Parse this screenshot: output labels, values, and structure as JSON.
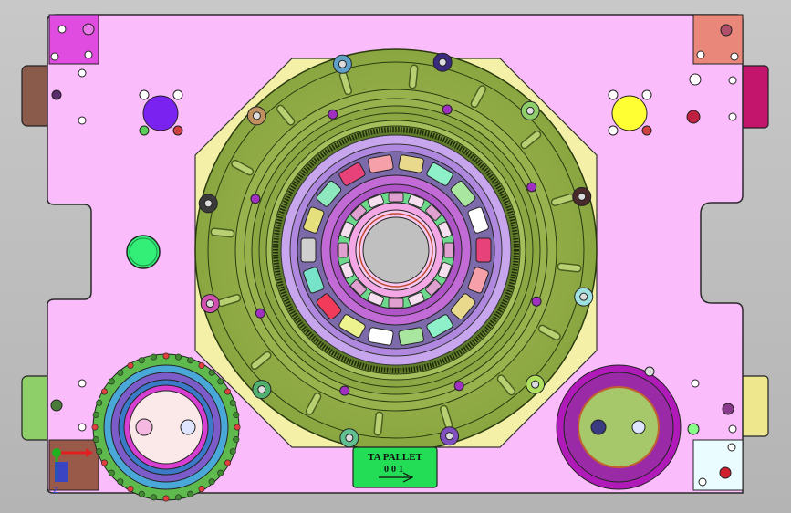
{
  "viewport": {
    "background": "#c0c0c0"
  },
  "pallet": {
    "plate_color": "#fbbcfb",
    "edge_color": "#2a2a2a"
  },
  "label_plate": {
    "line1": "TA PALLET",
    "line2": "001",
    "fill": "#22dd55",
    "arrow": "arrow-right-icon"
  },
  "colors": {
    "ring_green": "#9bb552",
    "ring_dark": "#7e9a3a",
    "yellow_pad": "#f4f0a8",
    "violet_ring": "#c7a6ee",
    "magenta_hub": "#c26ad6",
    "pink_inner": "#f3a7e4",
    "bearing_rollers": [
      "#e8427a",
      "#f6a1a9",
      "#e9d98c",
      "#8df0c8",
      "#a9e6a0",
      "#ffffff",
      "#ecf38f",
      "#f23b5a",
      "#77e3c9",
      "#cfcfcf",
      "#e5e07b",
      "#8de9bd"
    ],
    "corner_tl": "#e04be0",
    "corner_tr": "#e9887a",
    "corner_bl": "#8fcf6a",
    "corner_br": "#ffffff",
    "ear_left_top": "#8a5a4a",
    "ear_right_top": "#ffb81c",
    "ear_right_top2": "#c3156b",
    "ear_left_bottom": "#8fcf6a",
    "ear_right_bottom": "#d64bd2",
    "ear_right_bottom2": "#efe78d",
    "blue_disc": "#7a22f0",
    "yellow_disc": "#ffff33",
    "green_disc": "#33ee77",
    "gear_left_outer": "#5fba4d",
    "gear_right_outer": "#b01ab8"
  },
  "triad": {
    "x_color": "#e02020",
    "y_color": "#20b020",
    "z_color": "#2040e0",
    "z_label": "Z"
  }
}
